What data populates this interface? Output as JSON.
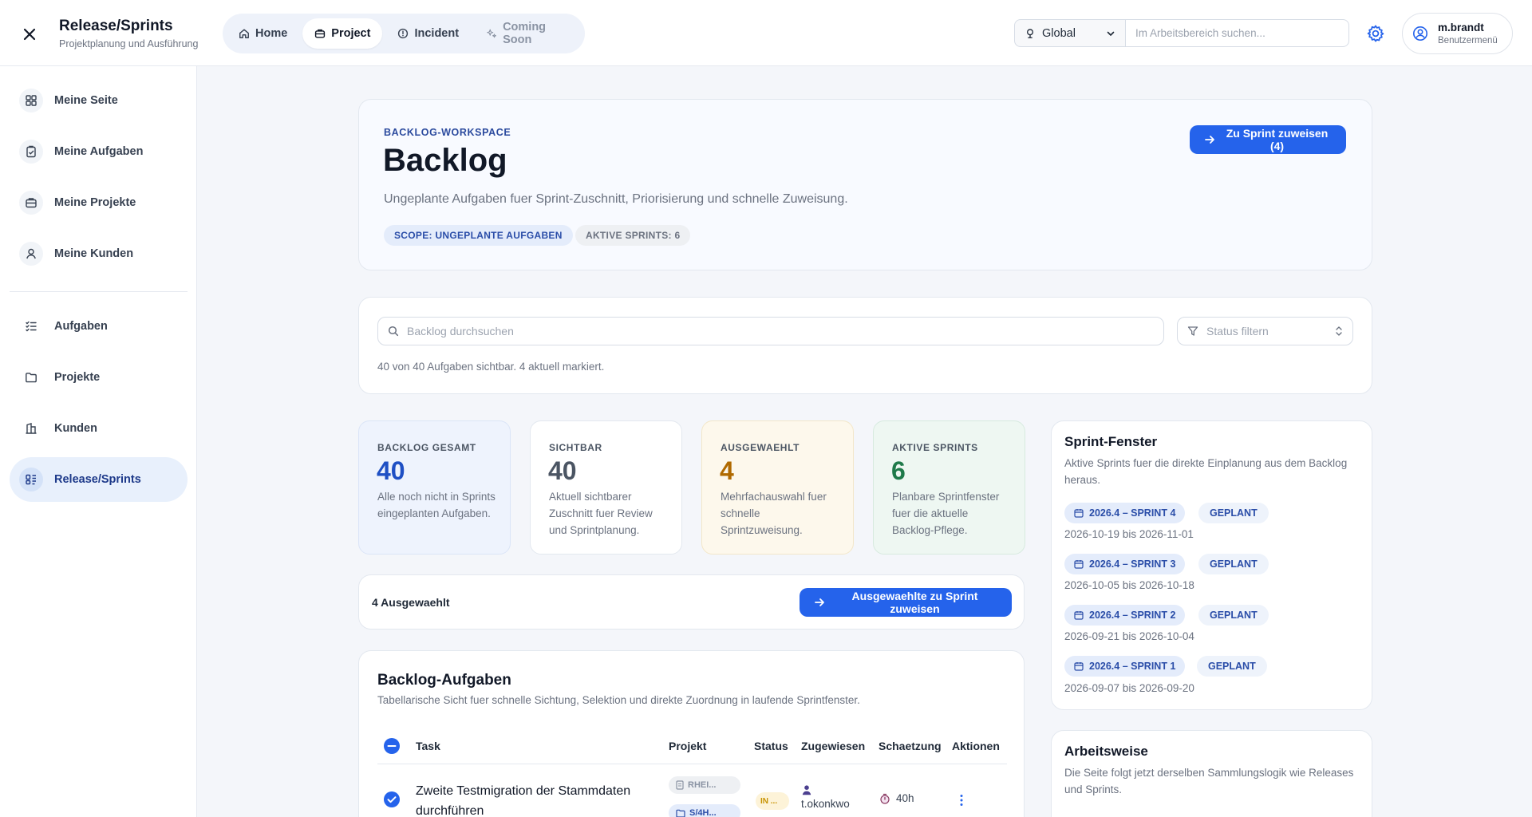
{
  "app": {
    "title": "Release/Sprints",
    "subtitle": "Projektplanung und Ausführung"
  },
  "topnav": {
    "tabs": [
      {
        "label": "Home",
        "icon": "home-icon",
        "active": false
      },
      {
        "label": "Project",
        "icon": "briefcase-icon",
        "active": true
      },
      {
        "label": "Incident",
        "icon": "alert-circle-icon",
        "active": false
      },
      {
        "label": "Coming Soon",
        "icon": "sparkle-icon",
        "active": false
      }
    ]
  },
  "scope": {
    "value": "Global"
  },
  "search": {
    "placeholder": "Im Arbeitsbereich suchen..."
  },
  "user": {
    "name": "m.brandt",
    "role": "Benutzermenü"
  },
  "sidebar": {
    "items": [
      {
        "label": "Meine Seite"
      },
      {
        "label": "Meine Aufgaben"
      },
      {
        "label": "Meine Projekte"
      },
      {
        "label": "Meine Kunden"
      },
      {
        "label": "Aufgaben"
      },
      {
        "label": "Projekte"
      },
      {
        "label": "Kunden"
      },
      {
        "label": "Release/Sprints"
      }
    ]
  },
  "hero": {
    "eyebrow": "BACKLOG-WORKSPACE",
    "title": "Backlog",
    "description": "Ungeplante Aufgaben fuer Sprint-Zuschnitt, Priorisierung und schnelle Zuweisung.",
    "pill_scope": "SCOPE: UNGEPLANTE AUFGABEN",
    "pill_sprints": "AKTIVE SPRINTS: 6",
    "assign_button": "Zu Sprint zuweisen (4)"
  },
  "filters": {
    "search_placeholder": "Backlog durchsuchen",
    "status_placeholder": "Status filtern",
    "info": "40 von 40 Aufgaben sichtbar. 4 aktuell markiert."
  },
  "stats": [
    {
      "label": "BACKLOG GESAMT",
      "value": "40",
      "desc": "Alle noch nicht in Sprints eingeplanten Aufgaben."
    },
    {
      "label": "SICHTBAR",
      "value": "40",
      "desc": "Aktuell sichtbarer Zuschnitt fuer Review und Sprintplanung."
    },
    {
      "label": "AUSGEWAEHLT",
      "value": "4",
      "desc": "Mehrfachauswahl fuer schnelle Sprintzuweisung."
    },
    {
      "label": "AKTIVE SPRINTS",
      "value": "6",
      "desc": "Planbare Sprintfenster fuer die aktuelle Backlog-Pflege."
    }
  ],
  "selection": {
    "count_label": "4 Ausgewaehlt",
    "button": "Ausgewaehlte zu Sprint zuweisen"
  },
  "table": {
    "title": "Backlog-Aufgaben",
    "subtitle": "Tabellarische Sicht fuer schnelle Sichtung, Selektion und direkte Zuordnung in laufende Sprintfenster.",
    "columns": [
      "Task",
      "Projekt",
      "Status",
      "Zugewiesen",
      "Schaetzung",
      "Aktionen"
    ],
    "rows": [
      {
        "task": "Zweite Testmigration der Stammdaten durchführen",
        "project": "RHEI...",
        "project_code": "S/4H...",
        "status": "IN ...",
        "assignee": "t.okonkwo",
        "estimate": "40h",
        "selected": true
      }
    ]
  },
  "sprint_panel": {
    "title": "Sprint-Fenster",
    "subtitle": "Aktive Sprints fuer die direkte Einplanung aus dem Backlog heraus.",
    "sprints": [
      {
        "name": "2026.4 – SPRINT 4",
        "state": "GEPLANT",
        "dates": "2026-10-19 bis 2026-11-01"
      },
      {
        "name": "2026.4 – SPRINT 3",
        "state": "GEPLANT",
        "dates": "2026-10-05 bis 2026-10-18"
      },
      {
        "name": "2026.4 – SPRINT 2",
        "state": "GEPLANT",
        "dates": "2026-09-21 bis 2026-10-04"
      },
      {
        "name": "2026.4 – SPRINT 1",
        "state": "GEPLANT",
        "dates": "2026-09-07 bis 2026-09-20"
      }
    ]
  },
  "work_panel": {
    "title": "Arbeitsweise",
    "subtitle": "Die Seite folgt jetzt derselben Sammlungslogik wie Releases und Sprints."
  },
  "colors": {
    "accent": "#2563eb",
    "active_nav_bg": "#e8f0fc",
    "stat_blue": "#1e4fc4",
    "stat_orange": "#b06a00",
    "stat_green": "#1f7a4a"
  }
}
